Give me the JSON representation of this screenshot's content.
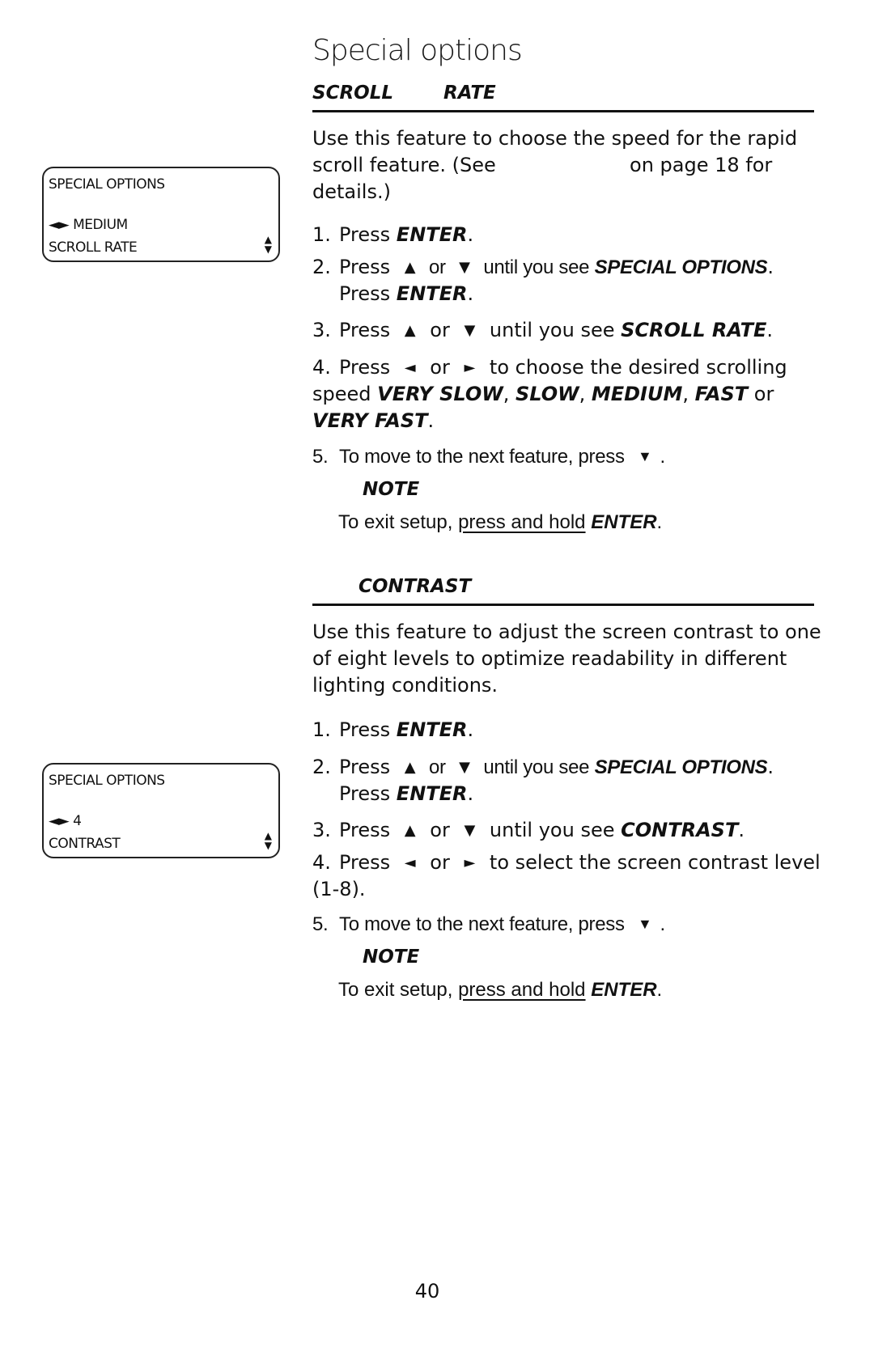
{
  "page": {
    "title": "Special options",
    "page_number": "40"
  },
  "scroll_rate": {
    "heading": [
      "SCROLL",
      "RATE"
    ],
    "intro_before_ref": "Use this feature to choose the speed for the rapid scroll feature. (See",
    "intro_ref_blank": "",
    "intro_after_ref": "on page 18 for details.)",
    "lcd": {
      "line1": "SPECIAL OPTIONS",
      "line3_arrows": "◄►",
      "line3_value": "MEDIUM",
      "line4": "SCROLL RATE",
      "updown": [
        "▲",
        "▼"
      ]
    },
    "steps": [
      {
        "num": "1.",
        "parts": [
          "Press ",
          "ENTER",
          "."
        ]
      },
      {
        "num": "2.",
        "parts": [
          "Press ",
          "▲",
          " or ",
          "▼",
          " until you see ",
          "SPECIAL OPTIONS",
          ".",
          "Press ",
          "ENTER",
          "."
        ]
      },
      {
        "num": "3.",
        "parts": [
          "Press ",
          "▲",
          " or ",
          "▼",
          " until you see ",
          "SCROLL RATE",
          "."
        ]
      },
      {
        "num": "4.",
        "parts": [
          "Press ",
          "◄",
          " or ",
          "►",
          " to choose the desired scrolling speed ",
          "VERY SLOW",
          ", ",
          "SLOW",
          ", ",
          "MEDIUM",
          ", ",
          "FAST",
          " or ",
          "VERY FAST",
          "."
        ]
      },
      {
        "num": "5.",
        "parts": [
          "To move to the next feature, press ",
          "▼",
          "."
        ]
      }
    ],
    "note_label": "NOTE",
    "note_text_before": "To exit setup, ",
    "note_text_underlined": "press and hold",
    "note_text_key": "ENTER",
    "note_text_after": "."
  },
  "contrast": {
    "heading": "CONTRAST",
    "intro": "Use this feature to adjust the screen contrast to one of eight levels to optimize readability in different lighting conditions.",
    "lcd": {
      "line1": "SPECIAL OPTIONS",
      "line3_arrows": "◄►",
      "line3_value": "4",
      "line4": "CONTRAST",
      "updown": [
        "▲",
        "▼"
      ]
    },
    "steps": [
      {
        "num": "1.",
        "parts": [
          "Press ",
          "ENTER",
          "."
        ]
      },
      {
        "num": "2.",
        "parts": [
          "Press ",
          "▲",
          " or ",
          "▼",
          " until you see ",
          "SPECIAL OPTIONS",
          ".",
          "Press ",
          "ENTER",
          "."
        ]
      },
      {
        "num": "3.",
        "parts": [
          "Press ",
          "▲",
          " or ",
          "▼",
          " until you see ",
          "CONTRAST",
          "."
        ]
      },
      {
        "num": "4.",
        "parts": [
          "Press ",
          "◄",
          " or ",
          "►",
          " to select the screen contrast level (1-8)."
        ]
      },
      {
        "num": "5.",
        "parts": [
          "To move to the next feature, press ",
          "▼",
          "."
        ]
      }
    ],
    "note_label": "NOTE",
    "note_text_before": "To exit setup, ",
    "note_text_underlined": "press and hold",
    "note_text_key": "ENTER",
    "note_text_after": "."
  }
}
